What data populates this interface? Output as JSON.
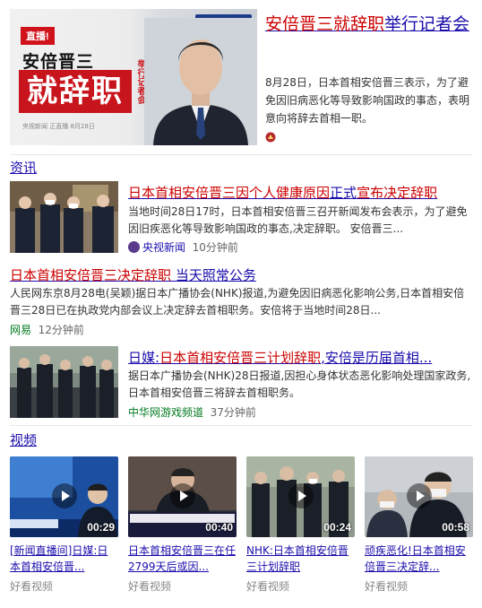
{
  "top": {
    "thumb_badge": "直播!",
    "thumb_name": "安倍晋三",
    "thumb_big": "就辞职",
    "thumb_side": "举行记者会",
    "thumb_source": "央视新闻 正直播   8月28日",
    "thumb_logo": "央视+正直播",
    "title_a": "安倍晋三",
    "title_b": "就辞职",
    "title_c": "举行记者会",
    "desc": "8月28日，日本首相安倍晋三表示，为了避免因旧病恶化等导致影响国政的事态，表明意向将辞去首相一职。"
  },
  "news_section": {
    "label": "资讯"
  },
  "news": [
    {
      "title_a": "日本首相",
      "title_b": "安倍晋三",
      "title_c": "因个人健康原因",
      "title_d": "正式",
      "title_e": "宣布决定",
      "title_f": "辞职",
      "desc": "当地时间28日17时，日本首相安倍晋三召开新闻发布会表示，为了避免因旧疾恶化等导致影响国政的事态,决定辞职。 安倍晋三...",
      "source": "央视新闻",
      "time": "10分钟前"
    },
    {
      "title_a": "日本首相",
      "title_b": "安倍晋三",
      "title_c": "决定",
      "title_d": "辞职",
      "title_e": " 当天照常公务",
      "desc": "人民网东京8月28电(吴颖)据日本广播协会(NHK)报道,为避免因旧病恶化影响公务,日本首相安倍晋三28日已在执政党内部会议上决定辞去首相职务。安倍将于当地时间28日...",
      "source": "网易",
      "time": "12分钟前"
    },
    {
      "title_a": "日媒:",
      "title_b": "日本首相",
      "title_c": "安倍晋三",
      "title_d": "计划",
      "title_e": "辞职",
      "title_f": ",安倍是历届首相...",
      "desc": "据日本广播协会(NHK)28日报道,因担心身体状态恶化影响处理国家政务,日本首相安倍晋三将辞去首相职务。",
      "source": "中华网游戏频道",
      "time": "37分钟前"
    }
  ],
  "video_section": {
    "label": "视频"
  },
  "videos": [
    {
      "duration": "00:29",
      "title": "[新闻直播间]日媒:日本首相安倍晋...",
      "source": "好看视频",
      "caption": "日媒：日本首相安倍..."
    },
    {
      "duration": "00:40",
      "title": "日本首相安倍晋三在任2799天后或因...",
      "source": "好看视频",
      "caption": "安倍连续执政满2799"
    },
    {
      "duration": "00:24",
      "title": "NHK:日本首相安倍晋三计划辞职",
      "source": "好看视频",
      "caption": ""
    },
    {
      "duration": "00:58",
      "title": "顽疾恶化!日本首相安倍晋三决定辞...",
      "source": "好看视频",
      "caption": ""
    }
  ],
  "colors": {
    "link": "#1a0dab",
    "highlight": "#cc0000",
    "source_green": "#007a20",
    "badge_red": "#c8151d"
  }
}
